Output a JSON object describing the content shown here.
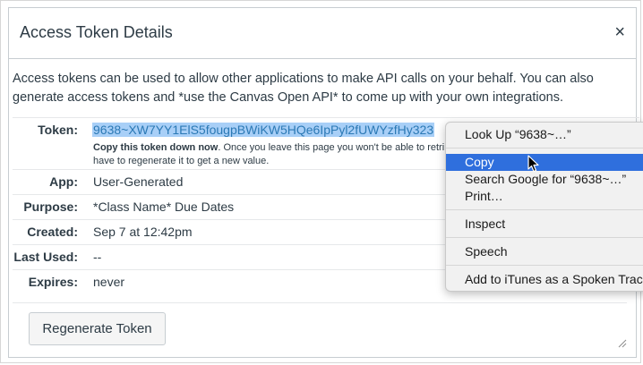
{
  "dialog": {
    "title": "Access Token Details",
    "close_symbol": "×",
    "intro": "Access tokens can be used to allow other applications to make API calls on your behalf. You can also generate access tokens and *use the Canvas Open API* to come up with your own integrations."
  },
  "token": {
    "label": "Token:",
    "value": "9638~XW7YY1ElS5fougpBWiKW5HQe6IpPyl2fUWYzfHy323",
    "note_bold": "Copy this token down now",
    "note_rest": ". Once you leave this page you won't be able to retri",
    "note_line2": "have to regenerate it to get a new value."
  },
  "details": [
    {
      "label": "App:",
      "value": "User-Generated"
    },
    {
      "label": "Purpose:",
      "value": "*Class Name* Due Dates"
    },
    {
      "label": "Created:",
      "value": "Sep 7 at 12:42pm"
    },
    {
      "label": "Last Used:",
      "value": "--"
    },
    {
      "label": "Expires:",
      "value": "never"
    }
  ],
  "regenerate_label": "Regenerate Token",
  "context_menu": {
    "items": [
      "Look Up “9638~…”",
      "Copy",
      "Search Google for “9638~…”",
      "Print…",
      "Inspect",
      "Speech",
      "Add to iTunes as a Spoken Track"
    ],
    "active_item": "Copy",
    "active_color": "#2f6fdd"
  }
}
